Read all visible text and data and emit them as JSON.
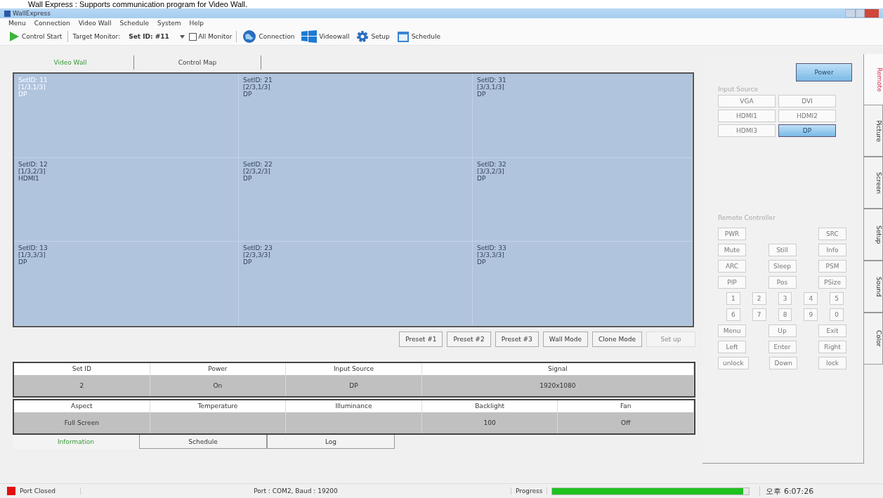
{
  "caption": "Wall Express : Supports communication program for Video Wall.",
  "window": {
    "title": "WallExpress"
  },
  "menu": [
    "Menu",
    "Connection",
    "Video Wall",
    "Schedule",
    "System",
    "Help"
  ],
  "toolbar": {
    "control_start": "Control Start",
    "target_label": "Target Monitor:",
    "target_value": "Set ID: #11",
    "all_monitor": {
      "label": "All Monitor",
      "checked": false
    },
    "buttons": [
      {
        "kind": "globe",
        "label": "Connection"
      },
      {
        "kind": "windows",
        "label": "Videowall"
      },
      {
        "kind": "gear",
        "label": "Setup"
      },
      {
        "kind": "calendar",
        "label": "Schedule"
      }
    ]
  },
  "view_tabs": [
    {
      "label": "Video Wall",
      "selected": true
    },
    {
      "label": "Control Map",
      "selected": false
    }
  ],
  "wall": [
    {
      "set_id": "SetID: 11",
      "position": "[1/3,1/3]",
      "source": "DP",
      "selected": true
    },
    {
      "set_id": "SetID: 21",
      "position": "[2/3,1/3]",
      "source": "DP",
      "selected": false
    },
    {
      "set_id": "SetID: 31",
      "position": "[3/3,1/3]",
      "source": "DP",
      "selected": false
    },
    {
      "set_id": "SetID: 12",
      "position": "[1/3,2/3]",
      "source": "HDMI1",
      "selected": false
    },
    {
      "set_id": "SetID: 22",
      "position": "[2/3,2/3]",
      "source": "DP",
      "selected": false
    },
    {
      "set_id": "SetID: 32",
      "position": "[3/3,2/3]",
      "source": "DP",
      "selected": false
    },
    {
      "set_id": "SetID: 13",
      "position": "[1/3,3/3]",
      "source": "DP",
      "selected": false
    },
    {
      "set_id": "SetID: 23",
      "position": "[2/3,3/3]",
      "source": "DP",
      "selected": false
    },
    {
      "set_id": "SetID: 33",
      "position": "[3/3,3/3]",
      "source": "DP",
      "selected": false
    }
  ],
  "wall_buttons": [
    {
      "label": "Preset #1",
      "disabled": false
    },
    {
      "label": "Preset #2",
      "disabled": false
    },
    {
      "label": "Preset #3",
      "disabled": false
    },
    {
      "label": "Wall Mode",
      "disabled": false
    },
    {
      "label": "Clone Mode",
      "disabled": false
    },
    {
      "label": "Set up",
      "disabled": true
    }
  ],
  "info_tables": [
    {
      "fields": [
        {
          "label": "Set ID",
          "value": "2"
        },
        {
          "label": "Power",
          "value": "On"
        },
        {
          "label": "Input Source",
          "value": "DP"
        },
        {
          "label": "Signal",
          "value": "1920x1080"
        }
      ]
    },
    {
      "fields": [
        {
          "label": "Aspect",
          "value": "Full Screen"
        },
        {
          "label": "Temperature"
        },
        {
          "label": "Illuminance"
        },
        {
          "label": "Backlight",
          "value": "100"
        },
        {
          "label": "Fan",
          "value": "Off"
        }
      ]
    }
  ],
  "bottom_tabs": [
    {
      "label": "Information",
      "selected": true
    },
    {
      "label": "Schedule",
      "selected": false
    },
    {
      "label": "Log",
      "selected": false
    }
  ],
  "power_button": {
    "label": "Power",
    "selected": true
  },
  "input_source": {
    "title": "Input Source",
    "buttons": [
      {
        "label": "VGA",
        "selected": false
      },
      {
        "label": "DVI",
        "selected": false
      },
      {
        "label": "HDMI1",
        "selected": false
      },
      {
        "label": "HDMI2",
        "selected": false
      },
      {
        "label": "HDMI3",
        "selected": false
      },
      {
        "label": "DP",
        "selected": true
      }
    ]
  },
  "remote": {
    "title": "Remote Controller",
    "rows": [
      [
        {
          "label": "PWR"
        },
        {},
        {
          "label": "SRC"
        }
      ],
      [
        {
          "label": "Mute"
        },
        {
          "label": "Still"
        },
        {
          "label": "Info"
        }
      ],
      [
        {
          "label": "ARC"
        },
        {
          "label": "Sleep"
        },
        {
          "label": "PSM"
        }
      ],
      [
        {
          "label": "PIP"
        },
        {
          "label": "Pos"
        },
        {
          "label": "PSize"
        }
      ],
      [
        {
          "label": "1"
        },
        {
          "label": "2"
        },
        {
          "label": "3"
        },
        {
          "label": "4"
        },
        {
          "label": "5"
        }
      ],
      [
        {
          "label": "6"
        },
        {
          "label": "7"
        },
        {
          "label": "8"
        },
        {
          "label": "9"
        },
        {
          "label": "0"
        }
      ],
      [
        {
          "label": "Menu"
        },
        {
          "label": "Up"
        },
        {
          "label": "Exit"
        }
      ],
      [
        {
          "label": "Left"
        },
        {
          "label": "Enter"
        },
        {
          "label": "Right"
        }
      ],
      [
        {
          "label": "unlock"
        },
        {
          "label": "Down"
        },
        {
          "label": "lock"
        }
      ]
    ]
  },
  "side_tabs": [
    {
      "label": "Remote",
      "selected": true
    },
    {
      "label": "Picture",
      "selected": false
    },
    {
      "label": "Screen",
      "selected": false
    },
    {
      "label": "Setup",
      "selected": false
    },
    {
      "label": "Sound",
      "selected": false
    },
    {
      "label": "Color",
      "selected": false
    }
  ],
  "status_bar": {
    "port_state": "Port Closed",
    "port_info": "Port : COM2,  Baud : 19200",
    "progress_label": "Progress",
    "progress": {
      "level": 0.97
    },
    "clock": "오후 6:07:26"
  }
}
